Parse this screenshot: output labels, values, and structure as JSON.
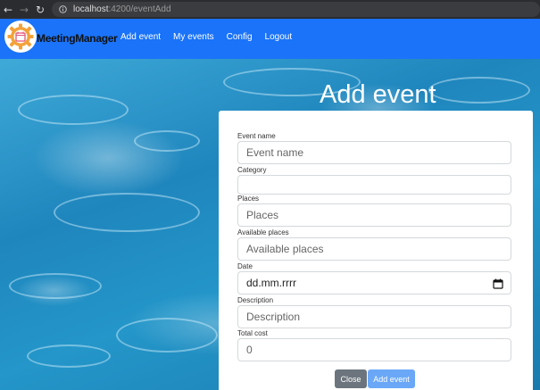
{
  "browser": {
    "url_host": "localhost",
    "url_path": ":4200/eventAdd"
  },
  "navbar": {
    "brand": "MeetingManager",
    "links": [
      "Add event",
      "My events",
      "Config",
      "Logout"
    ],
    "color": "#1a73f8"
  },
  "page": {
    "title": "Add event"
  },
  "form": {
    "event_name": {
      "label": "Event name",
      "placeholder": "Event name"
    },
    "category": {
      "label": "Category",
      "value": ""
    },
    "places": {
      "label": "Places",
      "placeholder": "Places"
    },
    "available_places": {
      "label": "Available places",
      "placeholder": "Available places"
    },
    "date": {
      "label": "Date",
      "value": "dd.mm.rrrr"
    },
    "description": {
      "label": "Description",
      "placeholder": "Description"
    },
    "total_cost": {
      "label": "Total cost",
      "value": "0"
    },
    "close_label": "Close",
    "submit_label": "Add event"
  },
  "icons": {
    "back": "arrow-left-icon",
    "forward": "arrow-right-icon",
    "reload": "reload-icon",
    "site_info": "info-icon",
    "calendar": "calendar-icon",
    "logo": "gear-logo-icon"
  }
}
